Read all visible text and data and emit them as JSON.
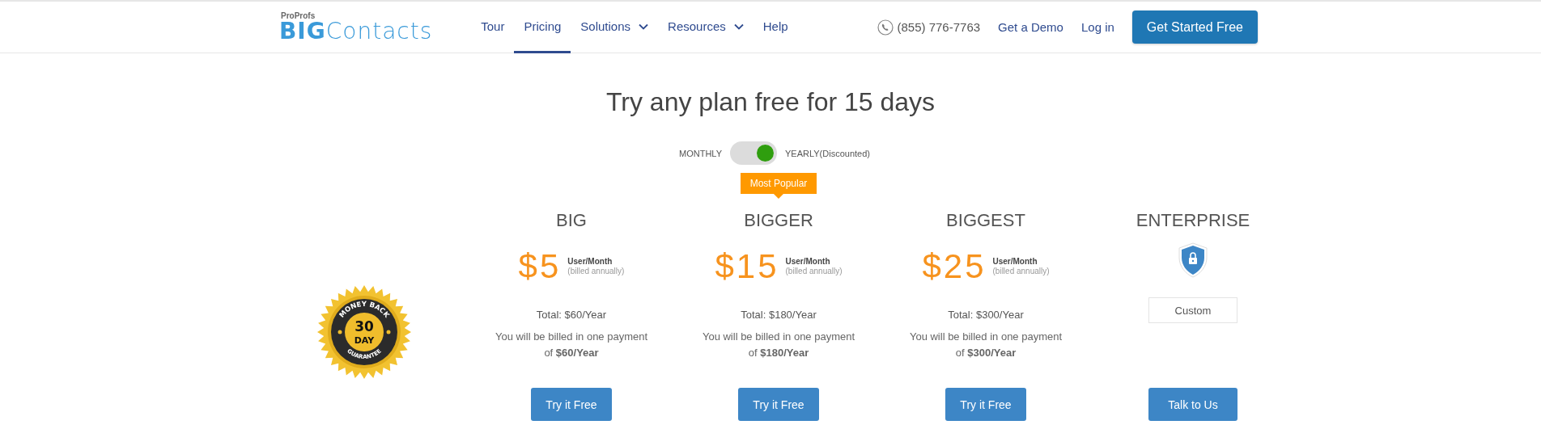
{
  "header": {
    "logo": {
      "small": "ProProfs",
      "big": "BIG",
      "rest": "Contacts"
    },
    "nav": [
      {
        "label": "Tour",
        "selected": false,
        "dropdown": false
      },
      {
        "label": "Pricing",
        "selected": true,
        "dropdown": false
      },
      {
        "label": "Solutions",
        "selected": false,
        "dropdown": true
      },
      {
        "label": "Resources",
        "selected": false,
        "dropdown": true
      },
      {
        "label": "Help",
        "selected": false,
        "dropdown": false
      }
    ],
    "phone": "(855) 776-7763",
    "links": [
      "Get a Demo",
      "Log in"
    ],
    "cta": "Get Started Free"
  },
  "title": "Try any plan free for 15 days",
  "billing_toggle": {
    "left_label": "MONTHLY",
    "right_label": "YEARLY(Discounted)",
    "on": true
  },
  "seal": {
    "top": "MONEY BACK",
    "number": "30",
    "unit": "DAY",
    "bottom": "GUARANTEE"
  },
  "plans": [
    {
      "kind": "priced",
      "name": "BIG",
      "price": "$5",
      "unit": "User/Month",
      "note": "(billed annually)",
      "total": "Total: $60/Year",
      "billing": "You will be billed in one payment of **$60/Year**",
      "button": "Try it Free"
    },
    {
      "kind": "priced",
      "name": "BIGGER",
      "badge": "Most Popular",
      "price": "$15",
      "unit": "User/Month",
      "note": "(billed annually)",
      "total": "Total: $180/Year",
      "billing": "You will be billed in one payment of **$180/Year**",
      "button": "Try it Free"
    },
    {
      "kind": "priced",
      "name": "BIGGEST",
      "price": "$25",
      "unit": "User/Month",
      "note": "(billed annually)",
      "total": "Total: $300/Year",
      "billing": "You will be billed in one payment of **$300/Year**",
      "button": "Try it Free"
    },
    {
      "kind": "custom",
      "name": "ENTERPRISE",
      "custom": "Custom",
      "button": "Talk to Us"
    }
  ]
}
